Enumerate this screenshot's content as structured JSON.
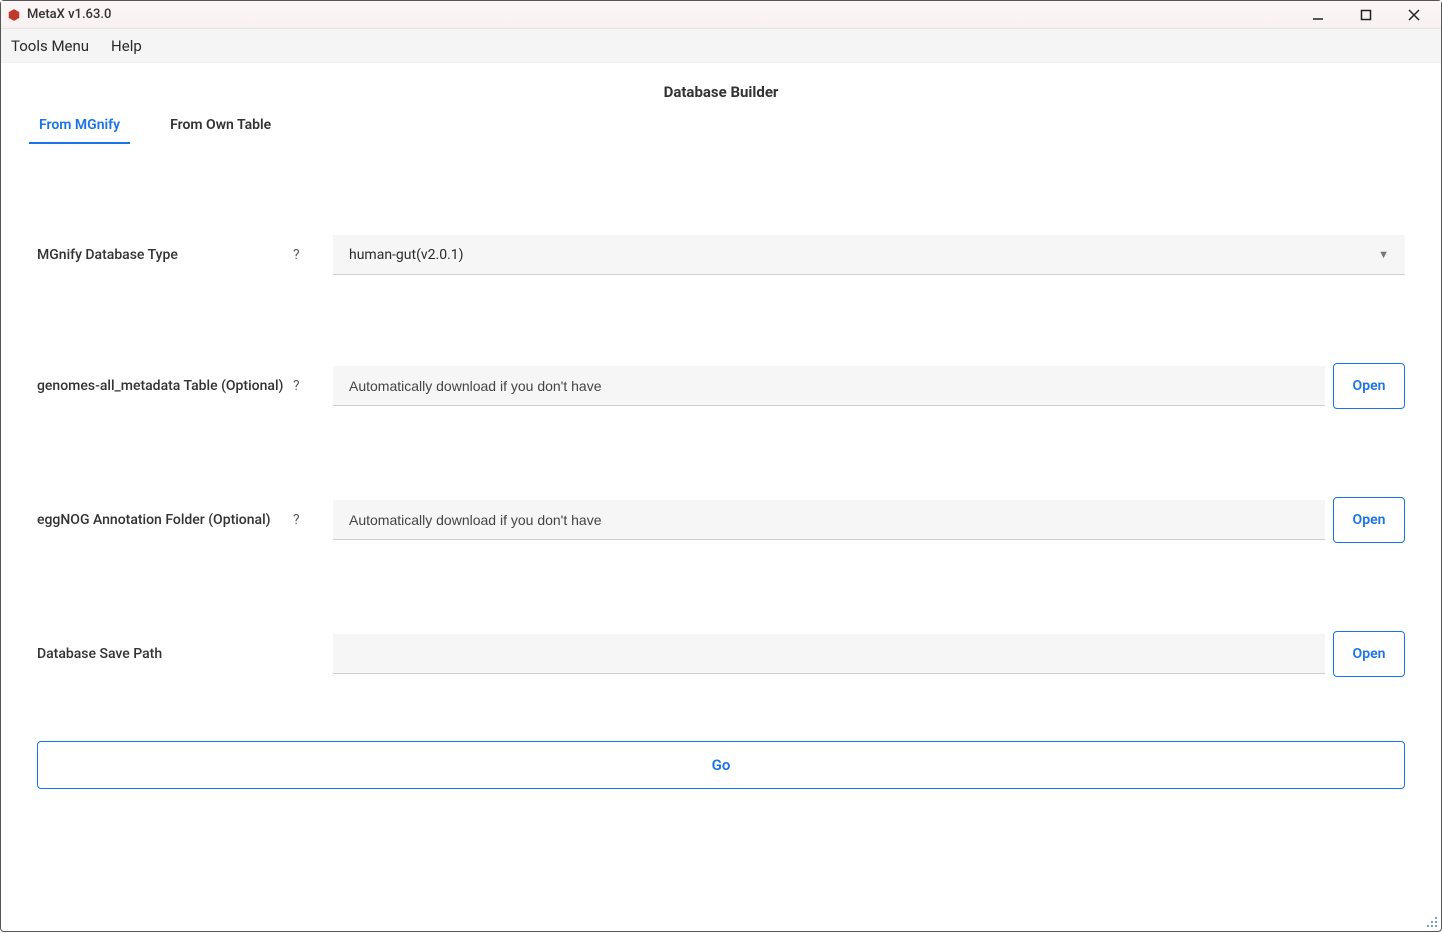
{
  "window": {
    "title": "MetaX v1.63.0"
  },
  "menubar": {
    "tools": "Tools Menu",
    "help": "Help"
  },
  "page": {
    "title": "Database Builder"
  },
  "tabs": {
    "mgnify": "From MGnify",
    "own": "From Own Table"
  },
  "fields": {
    "db_type": {
      "label": "MGnify Database Type",
      "help": "?",
      "value": "human-gut(v2.0.1)"
    },
    "metadata": {
      "label": "genomes-all_metadata Table (Optional)",
      "help": "?",
      "placeholder": "Automatically download if you don't have",
      "open": "Open"
    },
    "eggnog": {
      "label": "eggNOG Annotation Folder (Optional)",
      "help": "?",
      "placeholder": "Automatically download if you don't have",
      "open": "Open"
    },
    "save_path": {
      "label": "Database Save Path",
      "open": "Open"
    }
  },
  "actions": {
    "go": "Go"
  }
}
